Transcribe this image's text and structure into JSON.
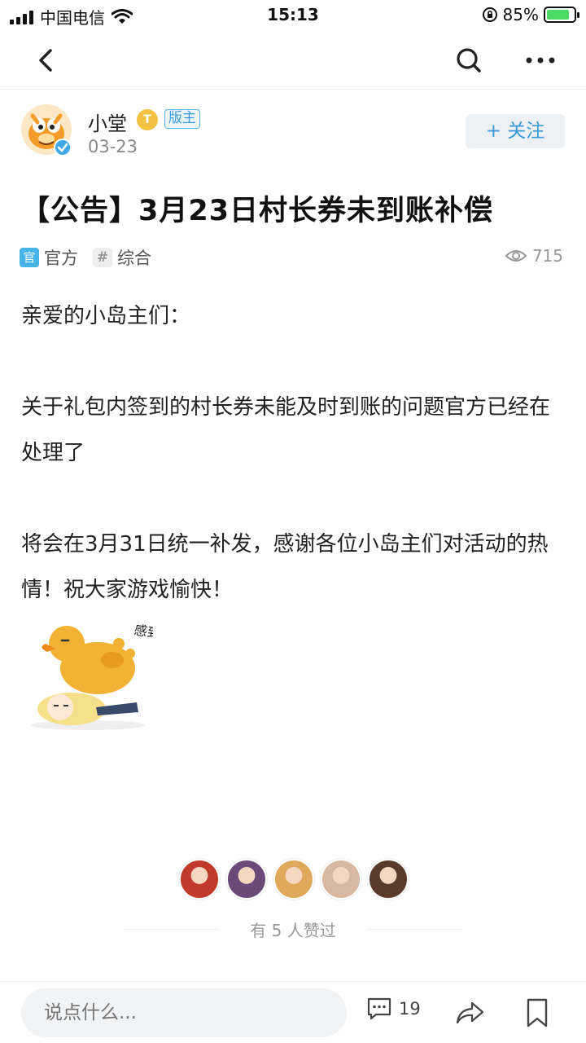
{
  "status_bar": {
    "carrier": "中国电信",
    "time": "15:13",
    "battery": "85%",
    "battery_level": 0.85
  },
  "nav": {
    "back_icon": "chevron-left-icon",
    "search_icon": "search-icon",
    "more_icon": "more-horizontal-icon"
  },
  "author": {
    "name": "小堂",
    "level_badge": "T",
    "role_badge": "版主",
    "date": "03-23",
    "follow_label": "+ 关注"
  },
  "post": {
    "title": "【公告】3月23日村长券未到账补偿",
    "tags": [
      "官方",
      "综合"
    ],
    "tag_icons": [
      "官",
      "#"
    ],
    "views": "715",
    "paragraphs": [
      "亲爱的小岛主们：",
      "关于礼包内签到的村长券未能及时到账的问题官方已经在处理了",
      "将会在3月31日统一补发，感谢各位小岛主们对活动的热情！祝大家游戏愉快！"
    ],
    "sticker_text": "感到鸭力…"
  },
  "likes": {
    "summary": "有 5 人赞过",
    "avatar_colors": [
      "#c0392b",
      "#6b4a7a",
      "#e0a85a",
      "#d8b8a0",
      "#5a3a2a"
    ]
  },
  "bottom_bar": {
    "comment_placeholder": "说点什么...",
    "comment_count": "19"
  },
  "colors": {
    "accent": "#3a9ad6",
    "official_tag": "#46b3e6"
  }
}
